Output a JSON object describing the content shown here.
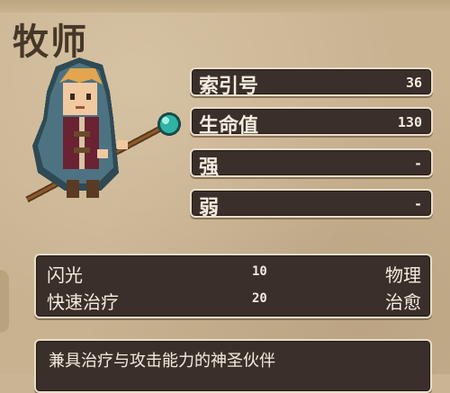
{
  "hero": {
    "name": "牧师",
    "portrait_icon": "priest-with-staff-icon"
  },
  "stats": [
    {
      "label": "索引号",
      "value": "36"
    },
    {
      "label": "生命值",
      "value": "130"
    },
    {
      "label": "强",
      "value": "-"
    },
    {
      "label": "弱",
      "value": "-"
    }
  ],
  "skills": [
    {
      "name": "闪光",
      "level": "10",
      "type": "物理"
    },
    {
      "name": "快速治疗",
      "level": "20",
      "type": "治愈"
    }
  ],
  "description": "兼具治疗与攻击能力的神圣伙伴",
  "colors": {
    "panel": "#3a2f2a",
    "panel_border": "#e8dccb",
    "parchment": "#c8b290",
    "title": "#463728"
  }
}
